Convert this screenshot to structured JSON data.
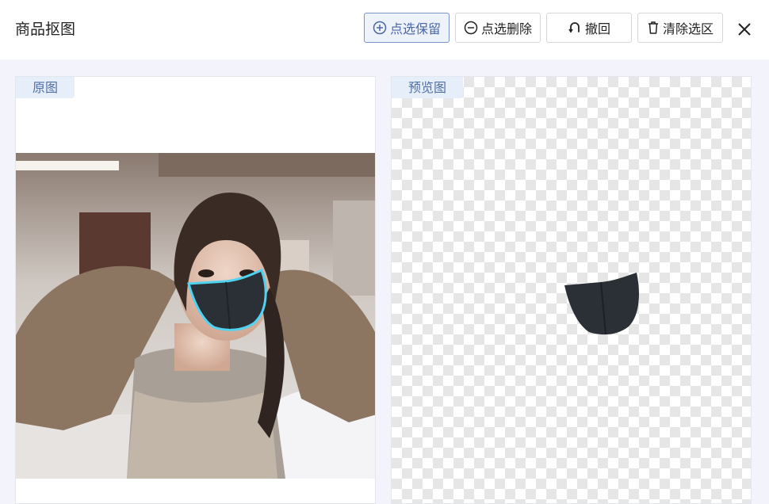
{
  "header": {
    "title": "商品抠图",
    "buttons": {
      "select_keep": "点选保留",
      "select_delete": "点选删除",
      "undo": "撤回",
      "clear": "清除选区"
    }
  },
  "panels": {
    "original_label": "原图",
    "preview_label": "预览图"
  },
  "colors": {
    "accent": "#4a67a8",
    "selection_outline": "#4fd3f0",
    "mask": "#2b3036"
  },
  "icons": {
    "select_keep": "plus-circle-icon",
    "select_delete": "minus-circle-icon",
    "undo": "undo-icon",
    "clear": "trash-icon",
    "close": "close-icon"
  }
}
